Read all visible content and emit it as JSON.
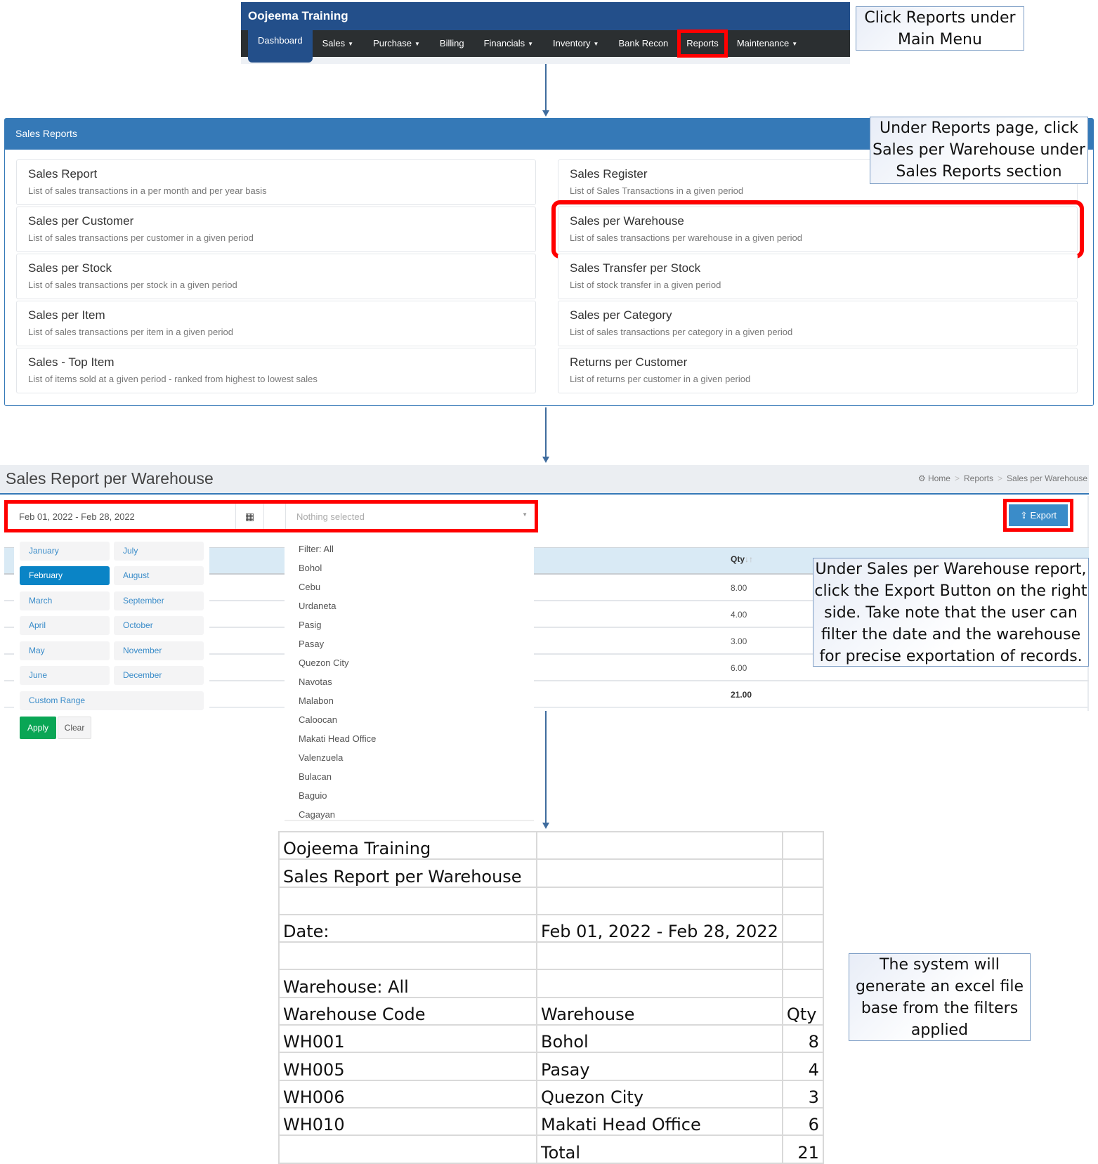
{
  "nav": {
    "brand": "Oojeema Training",
    "items": [
      {
        "label": "Dashboard",
        "dropdown": false
      },
      {
        "label": "Sales",
        "dropdown": true
      },
      {
        "label": "Purchase",
        "dropdown": true
      },
      {
        "label": "Billing",
        "dropdown": false
      },
      {
        "label": "Financials",
        "dropdown": true
      },
      {
        "label": "Inventory",
        "dropdown": true
      },
      {
        "label": "Bank Recon",
        "dropdown": false
      },
      {
        "label": "Reports",
        "dropdown": false
      },
      {
        "label": "Maintenance",
        "dropdown": true
      }
    ]
  },
  "callouts": {
    "step1": "Click Reports under Main Menu",
    "step2": "Under Reports page, click Sales per Warehouse under Sales Reports section",
    "step3": "Under Sales per Warehouse report, click the Export Button on the right side. Take note that the user can filter the date and the warehouse for precise exportation of records.",
    "step4": "The system will generate an excel file base from the filters applied"
  },
  "sales_reports": {
    "title": "Sales Reports",
    "left": [
      {
        "title": "Sales Report",
        "desc": "List of sales transactions in a per month and per year basis"
      },
      {
        "title": "Sales per Customer",
        "desc": "List of sales transactions per customer in a given period"
      },
      {
        "title": "Sales per Stock",
        "desc": "List of sales transactions per stock in a given period"
      },
      {
        "title": "Sales per Item",
        "desc": "List of sales transactions per item in a given period"
      },
      {
        "title": "Sales - Top Item",
        "desc": "List of items sold at a given period - ranked from highest to lowest sales"
      }
    ],
    "right": [
      {
        "title": "Sales Register",
        "desc": "List of Sales Transactions in a given period"
      },
      {
        "title": "Sales per Warehouse",
        "desc": "List of sales transactions per warehouse in a given period"
      },
      {
        "title": "Sales Transfer per Stock",
        "desc": "List of stock transfer in a given period"
      },
      {
        "title": "Sales per Category",
        "desc": "List of sales transactions per category in a given period"
      },
      {
        "title": "Returns per Customer",
        "desc": "List of returns per customer in a given period"
      }
    ]
  },
  "warehouse_page": {
    "title": "Sales Report per Warehouse",
    "breadcrumb": [
      "Home",
      "Reports",
      "Sales per Warehouse"
    ],
    "date_range": "Feb 01, 2022 - Feb 28, 2022",
    "warehouse_placeholder": "Nothing selected",
    "export_label": "Export",
    "qty_header": "Qty",
    "qty_values": [
      "8.00",
      "4.00",
      "3.00",
      "6.00"
    ],
    "qty_total": "21.00",
    "months_left": [
      "January",
      "February",
      "March",
      "April",
      "May",
      "June"
    ],
    "months_right": [
      "July",
      "August",
      "September",
      "October",
      "November",
      "December"
    ],
    "selected_month": "February",
    "custom_range": "Custom Range",
    "apply_label": "Apply",
    "clear_label": "Clear",
    "warehouse_options": [
      "Filter: All",
      "Bohol",
      "Cebu",
      "Urdaneta",
      "Pasig",
      "Pasay",
      "Quezon City",
      "Navotas",
      "Malabon",
      "Caloocan",
      "Makati Head Office",
      "Valenzuela",
      "Bulacan",
      "Baguio",
      "Cagayan"
    ]
  },
  "excel": {
    "company": "Oojeema Training",
    "report_title": "Sales Report per Warehouse",
    "date_label": "Date:",
    "date_value": "Feb 01, 2022 - Feb 28, 2022",
    "warehouse_filter": "Warehouse: All",
    "headers": [
      "Warehouse Code",
      "Warehouse",
      "Qty"
    ],
    "rows": [
      [
        "WH001",
        "Bohol",
        "8"
      ],
      [
        "WH005",
        "Pasay",
        "4"
      ],
      [
        "WH006",
        "Quezon City",
        "3"
      ],
      [
        "WH010",
        "Makati Head Office",
        "6"
      ]
    ],
    "total_label": "Total",
    "total_value": "21"
  }
}
